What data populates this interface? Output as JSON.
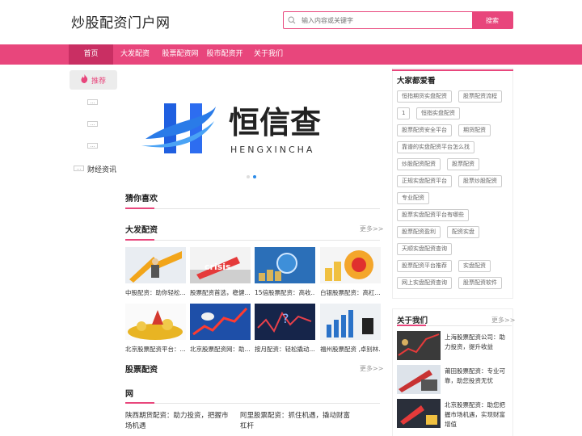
{
  "header": {
    "logo": "炒股配资门户网",
    "search_placeholder": "输入内容或关键字",
    "search_button": "搜索"
  },
  "nav": [
    "首页",
    "大发配资",
    "股票配资网",
    "股市配资开",
    "关于我们"
  ],
  "sidebar": {
    "recommend": "推荐",
    "placeholders": [
      "...",
      "...",
      "...",
      "..."
    ],
    "finance": "财经资讯"
  },
  "banner": {
    "brand_cn": "恒信查",
    "brand_en": "HENGXINCHA"
  },
  "sections": {
    "guess": "猜你喜欢",
    "dafa": "大发配资",
    "stock": "股票配资",
    "wang": "网",
    "more": "更多>>"
  },
  "cards": [
    "中股配资：助你轻松...",
    "股票配资首选，稳健...",
    "15倍股票配资：高收...",
    "白银股票配资：高杠...",
    "北京股票配资平台：...",
    "北京股票配资网：助...",
    "按月配资：轻松撬动...",
    "福州股票配资 ,卓别林..."
  ],
  "text_links": [
    "陕西期货配资：助力投资，把握市场机遇",
    "阿里股票配资：抓住机遇，撬动财富杠杆"
  ],
  "right": {
    "popular_title": "大家都爱看",
    "tags": [
      "恒指期货实盘配资",
      "股票配资流程",
      "1",
      "恒指实盘配资",
      "股票配资安全平台",
      "期货配资",
      "靠谱的实盘配资平台怎么找",
      "炒股配资配资",
      "股票配资",
      "正规实盘配资平台",
      "股票炒股配资",
      "专业配资",
      "股票实盘配资平台有哪些",
      "股票配资盈利",
      "配资实盘",
      "天顺实盘配资查询",
      "股票配资平台推荐",
      "实盘配资",
      "网上实盘配资查询",
      "股票配资软件"
    ],
    "about_title": "关于我们",
    "about_more": "更多>>",
    "about_items": [
      "上海股票配资公司：助力投资，提升收益",
      "莆田股票配资：专业可靠，助您投资无忧",
      "北京股票配资：助您把握市场机遇，实现财富增值"
    ]
  },
  "colors": {
    "accent": "#e8467c",
    "nav_active": "#c92f63",
    "dot_active": "#2b8be8"
  }
}
